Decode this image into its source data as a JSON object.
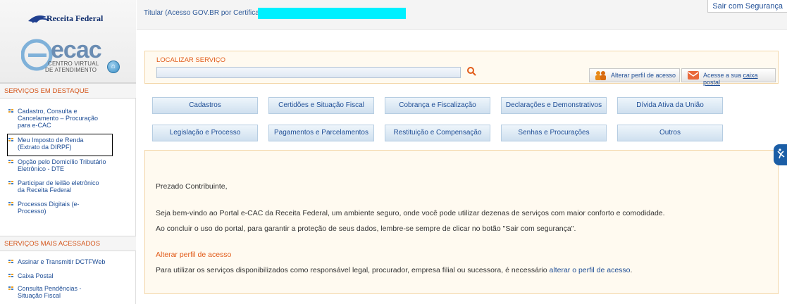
{
  "brand": {
    "receita": "Receita Federal",
    "ecac": "ecac",
    "ecac_sub1": "CENTRO VIRTUAL",
    "ecac_sub2": "DE ATENDIMENTO"
  },
  "topbar": {
    "titular_label": "Titular (Acesso GOV.BR por Certificado):",
    "logout_label": "Sair com Segurança"
  },
  "search": {
    "label": "LOCALIZAR SERVIÇO",
    "placeholder": "",
    "change_profile_label": "Alterar perfil de acesso",
    "mailbox_prefix": "Acesse a sua",
    "mailbox_link": "caixa postal"
  },
  "sidebar": {
    "featured_title": "SERVIÇOS EM DESTAQUE",
    "featured": [
      {
        "line1": "Cadastro, Consulta e",
        "line2": "Cancelamento – Procuração",
        "line3": "para e-CAC"
      },
      {
        "line1": "Meu Imposto de Renda",
        "line2": "(Extrato da DIRPF)",
        "line3": ""
      },
      {
        "line1": "Opção pelo Domicílio Tributário",
        "line2": "Eletrônico - DTE",
        "line3": ""
      },
      {
        "line1": "Participar de leilão eletrônico",
        "line2": "da Receita Federal",
        "line3": ""
      },
      {
        "line1": "Processos Digitais (e-",
        "line2": "Processo)",
        "line3": ""
      }
    ],
    "most_accessed_title": "SERVIÇOS MAIS ACESSADOS",
    "most_accessed": [
      {
        "line1": "Assinar e Transmitir DCTFWeb",
        "line2": ""
      },
      {
        "line1": "Caixa Postal",
        "line2": ""
      },
      {
        "line1": "Consulta Pendências -",
        "line2": "Situação Fiscal"
      }
    ]
  },
  "categories": [
    "Cadastros",
    "Certidões e Situação Fiscal",
    "Cobrança e Fiscalização",
    "Declarações e Demonstrativos",
    "Dívida Ativa da União",
    "Legislação e Processo",
    "Pagamentos e Parcelamentos",
    "Restituição e Compensação",
    "Senhas e Procurações",
    "Outros"
  ],
  "welcome": {
    "greeting": "Prezado Contribuinte,",
    "line1": "Seja bem-vindo ao Portal e-CAC da Receita Federal, um ambiente seguro, onde você pode utilizar dezenas de serviços com maior conforto e comodidade.",
    "line2": "Ao concluir o uso do portal, para garantir a proteção de seus dados, lembre-se sempre de clicar no botão \"Sair com segurança\".",
    "profile_title": "Alterar perfil de acesso",
    "line3_prefix": "Para utilizar os serviços disponibilizados como responsável legal, procurador, empresa filial ou sucessora, é necessário ",
    "line3_link": "alterar o perfil de acesso",
    "line3_suffix": "."
  },
  "colors": {
    "accent_orange": "#e15b19",
    "link_blue": "#1f4e96",
    "redacted_cyan": "#00f0ff"
  },
  "icons": [
    "home-icon",
    "search-icon",
    "users-icon",
    "mail-icon",
    "accessibility-icon",
    "bullet-icon"
  ]
}
